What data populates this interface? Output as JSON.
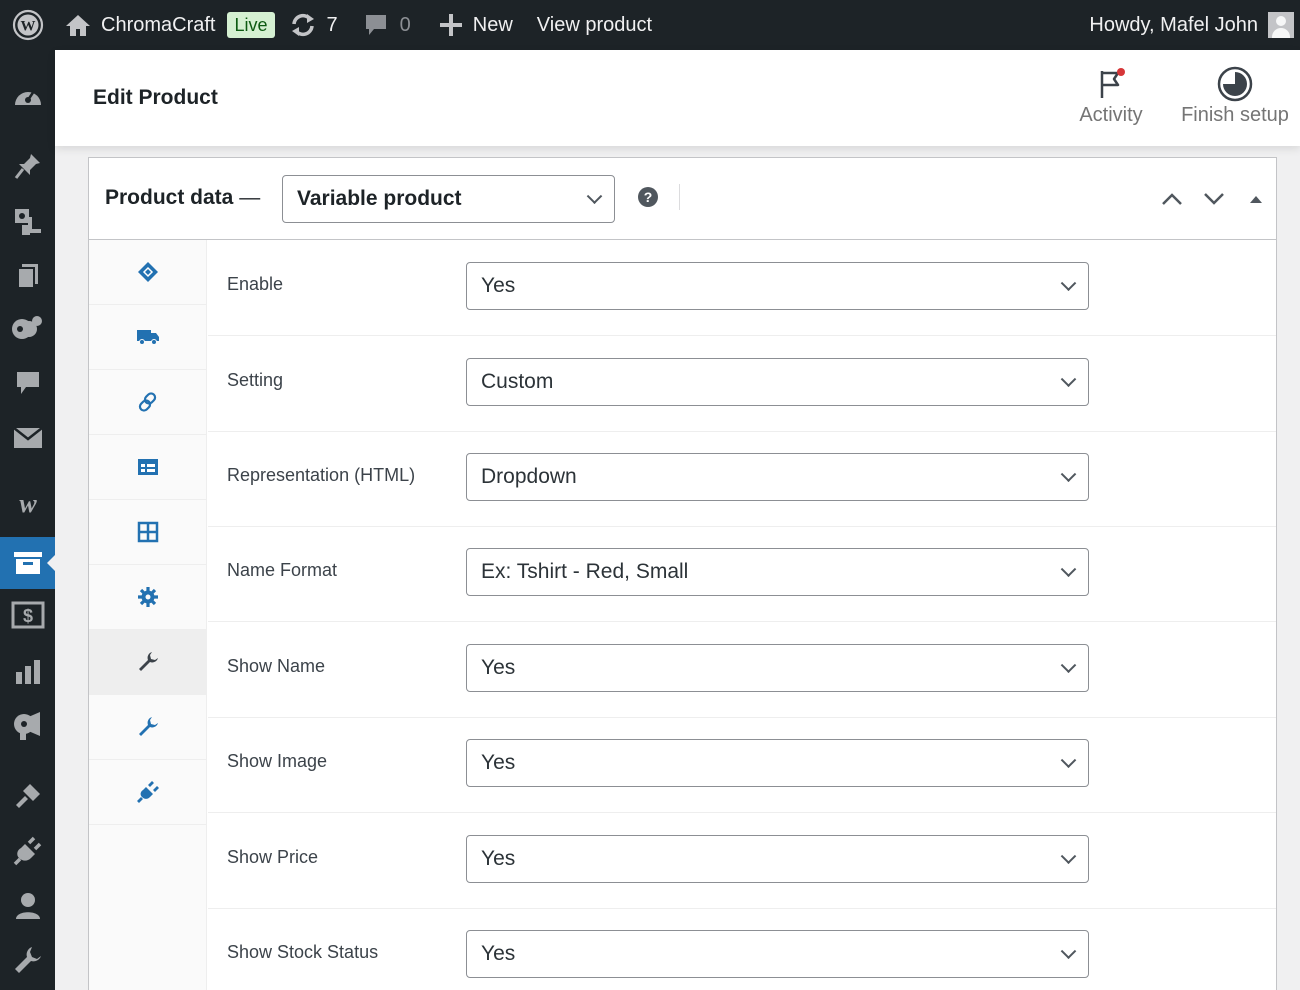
{
  "adminbar": {
    "wp_icon": "wordpress-logo-icon",
    "site_name": "ChromaCraft",
    "live_badge": "Live",
    "updates_count": "7",
    "comments_count": "0",
    "new_label": "New",
    "view_label": "View product",
    "greeting": "Howdy, Mafel John"
  },
  "header": {
    "title": "Edit Product",
    "activity_label": "Activity",
    "finish_label": "Finish setup"
  },
  "sidebar_icons": [
    "dashboard-icon",
    "pin-icon",
    "media-icon",
    "pages-icon",
    "comments-bubbles-icon",
    "comments-icon",
    "mail-icon",
    "woocommerce-icon",
    "products-icon",
    "payments-icon",
    "analytics-icon",
    "marketing-icon",
    "appearance-icon",
    "plugins-icon",
    "users-icon",
    "tools-icon"
  ],
  "product_data": {
    "title": "Product data",
    "dash": "—",
    "type_value": "Variable product",
    "help": "?"
  },
  "tabs": [
    {
      "icon": "tag-icon",
      "active": false
    },
    {
      "icon": "truck-icon",
      "active": false
    },
    {
      "icon": "link-icon",
      "active": false
    },
    {
      "icon": "attributes-icon",
      "active": false
    },
    {
      "icon": "variations-icon",
      "active": false
    },
    {
      "icon": "gear-icon",
      "active": false
    },
    {
      "icon": "wrench-icon",
      "active": true
    },
    {
      "icon": "wrench-icon",
      "active": false
    },
    {
      "icon": "plugin-icon",
      "active": false
    }
  ],
  "fields": [
    {
      "label": "Enable",
      "value": "Yes"
    },
    {
      "label": "Setting",
      "value": "Custom"
    },
    {
      "label": "Representation (HTML)",
      "value": "Dropdown"
    },
    {
      "label": "Name Format",
      "value": "Ex: Tshirt - Red, Small"
    },
    {
      "label": "Show Name",
      "value": "Yes"
    },
    {
      "label": "Show Image",
      "value": "Yes"
    },
    {
      "label": "Show Price",
      "value": "Yes"
    },
    {
      "label": "Show Stock Status",
      "value": "Yes"
    }
  ],
  "colors": {
    "admin_bar": "#1d2327",
    "accent": "#2271b1",
    "live_badge_bg": "#d5f0d2",
    "notification_dot": "#d63638"
  }
}
